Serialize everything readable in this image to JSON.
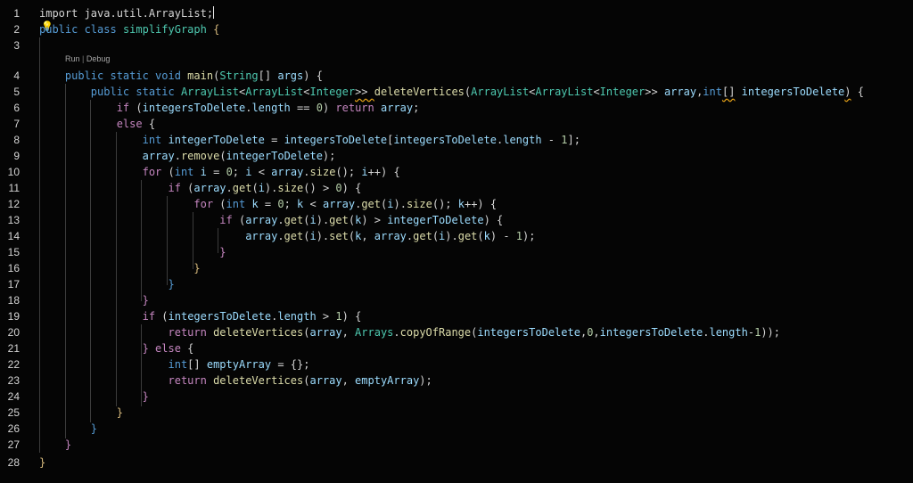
{
  "editor": {
    "codelens": {
      "run_label": "Run",
      "separator": "|",
      "debug_label": "Debug"
    },
    "lines": [
      {
        "n": "1",
        "tokens": [
          {
            "t": "import java.util.ArrayList;",
            "c": "pl"
          }
        ],
        "cursor": true
      },
      {
        "n": "2",
        "tokens": [
          {
            "t": "public",
            "c": "ty"
          },
          {
            "t": " class ",
            "c": "ty"
          },
          {
            "t": "simplifyGraph",
            "c": "cls"
          },
          {
            "t": " {",
            "c": "br"
          }
        ]
      },
      {
        "n": "3",
        "tokens": []
      },
      {
        "n": "4",
        "tokens": [
          {
            "t": "    public static void ",
            "c": "ty"
          },
          {
            "t": "main",
            "c": "fn"
          },
          {
            "t": "(",
            "c": "pl"
          },
          {
            "t": "String",
            "c": "cls"
          },
          {
            "t": "[] ",
            "c": "pl"
          },
          {
            "t": "args",
            "c": "var"
          },
          {
            "t": ") {",
            "c": "pl"
          }
        ]
      },
      {
        "n": "5",
        "tokens": [
          {
            "t": "        public static ",
            "c": "ty"
          },
          {
            "t": "ArrayList",
            "c": "cls"
          },
          {
            "t": "<",
            "c": "pl"
          },
          {
            "t": "ArrayList",
            "c": "cls"
          },
          {
            "t": "<",
            "c": "pl"
          },
          {
            "t": "Integer",
            "c": "cls"
          },
          {
            "t": ">> ",
            "c": "pl",
            "sq": "y"
          },
          {
            "t": "deleteVertices",
            "c": "fn"
          },
          {
            "t": "(",
            "c": "pl"
          },
          {
            "t": "ArrayList",
            "c": "cls"
          },
          {
            "t": "<",
            "c": "pl"
          },
          {
            "t": "ArrayList",
            "c": "cls"
          },
          {
            "t": "<",
            "c": "pl"
          },
          {
            "t": "Integer",
            "c": "cls"
          },
          {
            "t": ">> ",
            "c": "pl"
          },
          {
            "t": "array",
            "c": "var"
          },
          {
            "t": ",",
            "c": "pl"
          },
          {
            "t": "int",
            "c": "ty"
          },
          {
            "t": "[]",
            "c": "pl",
            "sq": "y"
          },
          {
            "t": " ",
            "c": "pl"
          },
          {
            "t": "integersToDelete",
            "c": "var"
          },
          {
            "t": ")",
            "c": "pl",
            "sq": "y"
          },
          {
            "t": " {",
            "c": "pl"
          }
        ]
      },
      {
        "n": "6",
        "tokens": [
          {
            "t": "            if ",
            "c": "kw"
          },
          {
            "t": "(",
            "c": "pl"
          },
          {
            "t": "integersToDelete",
            "c": "var"
          },
          {
            "t": ".",
            "c": "pl"
          },
          {
            "t": "length",
            "c": "var"
          },
          {
            "t": " == ",
            "c": "pl"
          },
          {
            "t": "0",
            "c": "num"
          },
          {
            "t": ") ",
            "c": "pl"
          },
          {
            "t": "return ",
            "c": "kw"
          },
          {
            "t": "array",
            "c": "var"
          },
          {
            "t": ";",
            "c": "pl"
          }
        ]
      },
      {
        "n": "7",
        "tokens": [
          {
            "t": "            else ",
            "c": "kw"
          },
          {
            "t": "{",
            "c": "pl"
          }
        ]
      },
      {
        "n": "8",
        "tokens": [
          {
            "t": "                int ",
            "c": "ty"
          },
          {
            "t": "integerToDelete",
            "c": "var"
          },
          {
            "t": " = ",
            "c": "pl"
          },
          {
            "t": "integersToDelete",
            "c": "var"
          },
          {
            "t": "[",
            "c": "pl"
          },
          {
            "t": "integersToDelete",
            "c": "var"
          },
          {
            "t": ".",
            "c": "pl"
          },
          {
            "t": "length",
            "c": "var"
          },
          {
            "t": " - ",
            "c": "pl"
          },
          {
            "t": "1",
            "c": "num"
          },
          {
            "t": "];",
            "c": "pl"
          }
        ]
      },
      {
        "n": "9",
        "tokens": [
          {
            "t": "                array",
            "c": "var"
          },
          {
            "t": ".",
            "c": "pl"
          },
          {
            "t": "remove",
            "c": "fn"
          },
          {
            "t": "(",
            "c": "pl"
          },
          {
            "t": "integerToDelete",
            "c": "var"
          },
          {
            "t": ");",
            "c": "pl"
          }
        ]
      },
      {
        "n": "10",
        "tokens": [
          {
            "t": "                for ",
            "c": "kw"
          },
          {
            "t": "(",
            "c": "pl"
          },
          {
            "t": "int ",
            "c": "ty"
          },
          {
            "t": "i",
            "c": "var"
          },
          {
            "t": " = ",
            "c": "pl"
          },
          {
            "t": "0",
            "c": "num"
          },
          {
            "t": "; ",
            "c": "pl"
          },
          {
            "t": "i",
            "c": "var"
          },
          {
            "t": " < ",
            "c": "pl"
          },
          {
            "t": "array",
            "c": "var"
          },
          {
            "t": ".",
            "c": "pl"
          },
          {
            "t": "size",
            "c": "fn"
          },
          {
            "t": "(); ",
            "c": "pl"
          },
          {
            "t": "i",
            "c": "var"
          },
          {
            "t": "++) {",
            "c": "pl"
          }
        ]
      },
      {
        "n": "11",
        "tokens": [
          {
            "t": "                    if ",
            "c": "kw"
          },
          {
            "t": "(",
            "c": "pl"
          },
          {
            "t": "array",
            "c": "var"
          },
          {
            "t": ".",
            "c": "pl"
          },
          {
            "t": "get",
            "c": "fn"
          },
          {
            "t": "(",
            "c": "pl"
          },
          {
            "t": "i",
            "c": "var"
          },
          {
            "t": ").",
            "c": "pl"
          },
          {
            "t": "size",
            "c": "fn"
          },
          {
            "t": "() > ",
            "c": "pl"
          },
          {
            "t": "0",
            "c": "num"
          },
          {
            "t": ") {",
            "c": "pl"
          }
        ]
      },
      {
        "n": "12",
        "tokens": [
          {
            "t": "                        for ",
            "c": "kw"
          },
          {
            "t": "(",
            "c": "pl"
          },
          {
            "t": "int ",
            "c": "ty"
          },
          {
            "t": "k",
            "c": "var"
          },
          {
            "t": " = ",
            "c": "pl"
          },
          {
            "t": "0",
            "c": "num"
          },
          {
            "t": "; ",
            "c": "pl"
          },
          {
            "t": "k",
            "c": "var"
          },
          {
            "t": " < ",
            "c": "pl"
          },
          {
            "t": "array",
            "c": "var"
          },
          {
            "t": ".",
            "c": "pl"
          },
          {
            "t": "get",
            "c": "fn"
          },
          {
            "t": "(",
            "c": "pl"
          },
          {
            "t": "i",
            "c": "var"
          },
          {
            "t": ").",
            "c": "pl"
          },
          {
            "t": "size",
            "c": "fn"
          },
          {
            "t": "(); ",
            "c": "pl"
          },
          {
            "t": "k",
            "c": "var"
          },
          {
            "t": "++) {",
            "c": "pl"
          }
        ]
      },
      {
        "n": "13",
        "tokens": [
          {
            "t": "                            if ",
            "c": "kw"
          },
          {
            "t": "(",
            "c": "pl"
          },
          {
            "t": "array",
            "c": "var"
          },
          {
            "t": ".",
            "c": "pl"
          },
          {
            "t": "get",
            "c": "fn"
          },
          {
            "t": "(",
            "c": "pl"
          },
          {
            "t": "i",
            "c": "var"
          },
          {
            "t": ").",
            "c": "pl"
          },
          {
            "t": "get",
            "c": "fn"
          },
          {
            "t": "(",
            "c": "pl"
          },
          {
            "t": "k",
            "c": "var"
          },
          {
            "t": ") > ",
            "c": "pl"
          },
          {
            "t": "integerToDelete",
            "c": "var"
          },
          {
            "t": ") {",
            "c": "pl"
          }
        ]
      },
      {
        "n": "14",
        "tokens": [
          {
            "t": "                                array",
            "c": "var"
          },
          {
            "t": ".",
            "c": "pl"
          },
          {
            "t": "get",
            "c": "fn"
          },
          {
            "t": "(",
            "c": "pl"
          },
          {
            "t": "i",
            "c": "var"
          },
          {
            "t": ").",
            "c": "pl"
          },
          {
            "t": "set",
            "c": "fn"
          },
          {
            "t": "(",
            "c": "pl"
          },
          {
            "t": "k",
            "c": "var"
          },
          {
            "t": ", ",
            "c": "pl"
          },
          {
            "t": "array",
            "c": "var"
          },
          {
            "t": ".",
            "c": "pl"
          },
          {
            "t": "get",
            "c": "fn"
          },
          {
            "t": "(",
            "c": "pl"
          },
          {
            "t": "i",
            "c": "var"
          },
          {
            "t": ").",
            "c": "pl"
          },
          {
            "t": "get",
            "c": "fn"
          },
          {
            "t": "(",
            "c": "pl"
          },
          {
            "t": "k",
            "c": "var"
          },
          {
            "t": ") - ",
            "c": "pl"
          },
          {
            "t": "1",
            "c": "num"
          },
          {
            "t": ");",
            "c": "pl"
          }
        ]
      },
      {
        "n": "15",
        "tokens": [
          {
            "t": "                            }",
            "c": "kw"
          }
        ]
      },
      {
        "n": "16",
        "tokens": [
          {
            "t": "                        }",
            "c": "br"
          }
        ]
      },
      {
        "n": "17",
        "tokens": [
          {
            "t": "                    }",
            "c": "ty"
          }
        ]
      },
      {
        "n": "18",
        "tokens": [
          {
            "t": "                }",
            "c": "kw"
          }
        ]
      },
      {
        "n": "19",
        "tokens": [
          {
            "t": "                if ",
            "c": "kw"
          },
          {
            "t": "(",
            "c": "pl"
          },
          {
            "t": "integersToDelete",
            "c": "var"
          },
          {
            "t": ".",
            "c": "pl"
          },
          {
            "t": "length",
            "c": "var"
          },
          {
            "t": " > ",
            "c": "pl"
          },
          {
            "t": "1",
            "c": "num"
          },
          {
            "t": ") {",
            "c": "pl"
          }
        ]
      },
      {
        "n": "20",
        "tokens": [
          {
            "t": "                    return ",
            "c": "kw"
          },
          {
            "t": "deleteVertices",
            "c": "fn"
          },
          {
            "t": "(",
            "c": "pl"
          },
          {
            "t": "array",
            "c": "var"
          },
          {
            "t": ", ",
            "c": "pl"
          },
          {
            "t": "Arrays",
            "c": "cls"
          },
          {
            "t": ".",
            "c": "pl"
          },
          {
            "t": "copyOfRange",
            "c": "fn"
          },
          {
            "t": "(",
            "c": "pl"
          },
          {
            "t": "integersToDelete",
            "c": "var"
          },
          {
            "t": ",",
            "c": "pl"
          },
          {
            "t": "0",
            "c": "num"
          },
          {
            "t": ",",
            "c": "pl"
          },
          {
            "t": "integersToDelete",
            "c": "var"
          },
          {
            "t": ".",
            "c": "pl"
          },
          {
            "t": "length",
            "c": "var"
          },
          {
            "t": "-",
            "c": "pl"
          },
          {
            "t": "1",
            "c": "num"
          },
          {
            "t": "));",
            "c": "pl"
          }
        ]
      },
      {
        "n": "21",
        "tokens": [
          {
            "t": "                } ",
            "c": "kw"
          },
          {
            "t": "else ",
            "c": "kw"
          },
          {
            "t": "{",
            "c": "pl"
          }
        ]
      },
      {
        "n": "22",
        "tokens": [
          {
            "t": "                    int",
            "c": "ty"
          },
          {
            "t": "[] ",
            "c": "pl"
          },
          {
            "t": "emptyArray",
            "c": "var"
          },
          {
            "t": " = {};",
            "c": "pl"
          }
        ]
      },
      {
        "n": "23",
        "tokens": [
          {
            "t": "                    return ",
            "c": "kw"
          },
          {
            "t": "deleteVertices",
            "c": "fn"
          },
          {
            "t": "(",
            "c": "pl"
          },
          {
            "t": "array",
            "c": "var"
          },
          {
            "t": ", ",
            "c": "pl"
          },
          {
            "t": "emptyArray",
            "c": "var"
          },
          {
            "t": ");",
            "c": "pl"
          }
        ]
      },
      {
        "n": "24",
        "tokens": [
          {
            "t": "                }",
            "c": "kw"
          }
        ]
      },
      {
        "n": "25",
        "tokens": [
          {
            "t": "            }",
            "c": "br"
          }
        ]
      },
      {
        "n": "26",
        "tokens": [
          {
            "t": "        }",
            "c": "ty"
          }
        ]
      },
      {
        "n": "27",
        "tokens": [
          {
            "t": "    }",
            "c": "kw"
          }
        ]
      },
      {
        "n": "28",
        "tokens": [
          {
            "t": "}",
            "c": "br"
          }
        ]
      }
    ]
  },
  "colors": {
    "background": "#050505",
    "keyword": "#c586c0",
    "type": "#569cd6",
    "class": "#4ec9b0",
    "function": "#dcdcaa",
    "variable": "#9cdcfe",
    "number": "#b5cea8",
    "warning_squiggle": "#e8a317"
  },
  "icons": {
    "lightbulb": "lightbulb-icon"
  }
}
